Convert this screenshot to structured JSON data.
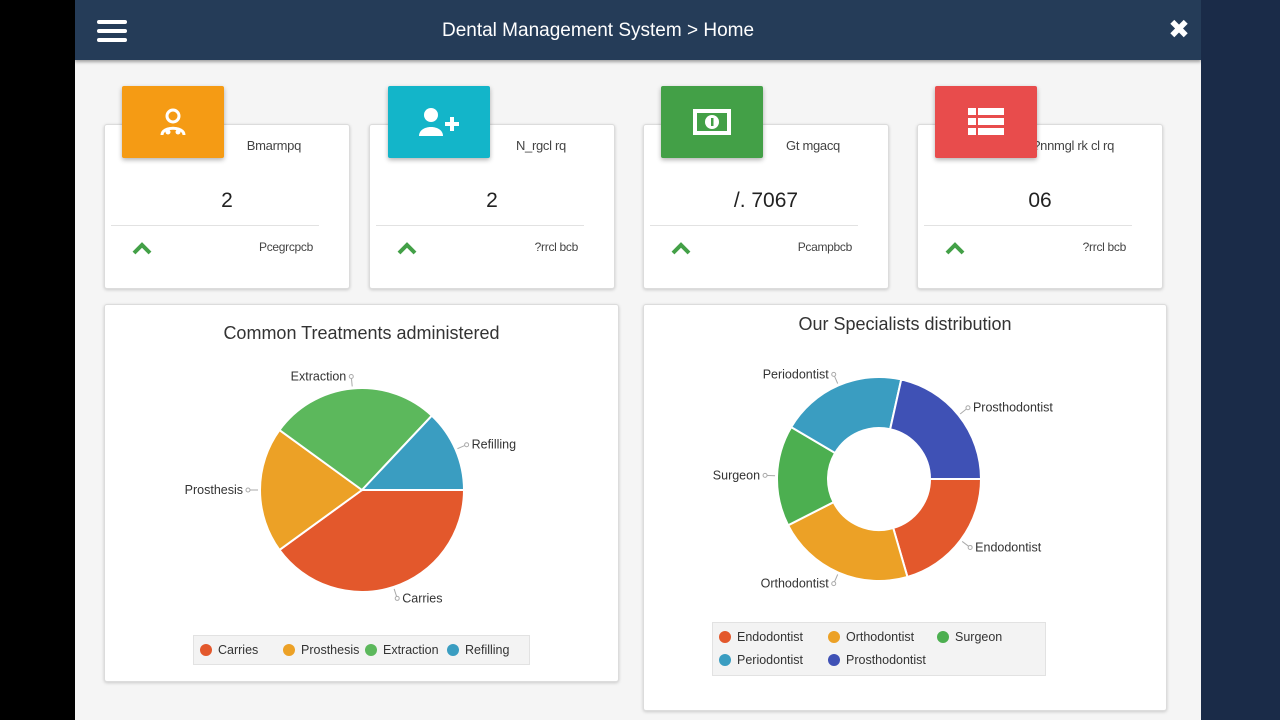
{
  "header": {
    "title": "Dental Management System > Home"
  },
  "cards": [
    {
      "label": "Bmarmpq",
      "value": "2",
      "footer": "Pcegrcpcb",
      "color": "#f59b14"
    },
    {
      "label": "N_rgcl rq",
      "value": "2",
      "footer": "?rrcl bcb",
      "color": "#13b5c9"
    },
    {
      "label": "Gt mgacq",
      "value": "/. 7067",
      "footer": "Pcampbcb",
      "color": "#43a047"
    },
    {
      "label": "?nnmgl rk cl rq",
      "value": "06",
      "footer": "?rrcl bcb",
      "color": "#e84c4c"
    }
  ],
  "card_icons": [
    "doctor-icon",
    "add-user-icon",
    "money-icon",
    "list-icon"
  ],
  "charts": {
    "treatments": {
      "title": "Common Treatments administered",
      "legend": [
        "Carries",
        "Prosthesis",
        "Extraction",
        "Refilling"
      ]
    },
    "specialists": {
      "title": "Our Specialists distribution",
      "legend": [
        "Endodontist",
        "Orthodontist",
        "Surgeon",
        "Periodontist",
        "Prosthodontist"
      ]
    }
  },
  "chart_data": [
    {
      "type": "pie",
      "title": "Common Treatments administered",
      "categories": [
        "Carries",
        "Prosthesis",
        "Extraction",
        "Refilling"
      ],
      "values": [
        40,
        20,
        27,
        13
      ],
      "colors": [
        "#e3582c",
        "#eca126",
        "#5cb85c",
        "#3a9dc1"
      ]
    },
    {
      "type": "pie",
      "title": "Our Specialists distribution",
      "categories": [
        "Endodontist",
        "Orthodontist",
        "Surgeon",
        "Periodontist",
        "Prosthodontist"
      ],
      "values": [
        20.5,
        22,
        16,
        20,
        21.5
      ],
      "colors": [
        "#e3582c",
        "#eca126",
        "#4caf50",
        "#3a9dc1",
        "#3f51b5"
      ]
    }
  ]
}
